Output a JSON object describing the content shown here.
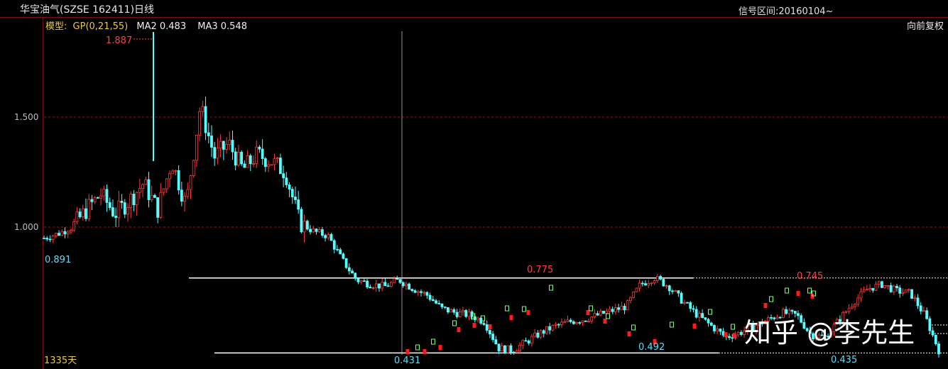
{
  "header": {
    "title": "华宝油气(SZSE 162411)日线",
    "signal_range": "信号区间:20160104~",
    "adjust": "向前复权",
    "period_days": "1335天"
  },
  "indicators": {
    "label": "模型:",
    "gp": "GP(0,21,55)",
    "ma2": "MA2 0.483",
    "ma3": "MA3 0.548"
  },
  "watermark": "知乎 @李先生",
  "colors": {
    "up": "#ff3c3c",
    "down": "#54ffff",
    "grid": "#8b1a1a",
    "buy": "#ff1a1a",
    "sell": "#7cff7c"
  },
  "chart_data": {
    "type": "candlestick",
    "ylim": [
      0.43,
      1.9
    ],
    "yticks": [
      {
        "value": 1.5,
        "label": "1.500"
      },
      {
        "value": 1.0,
        "label": "1.000"
      }
    ],
    "annotations": [
      {
        "label": "1.887",
        "value": 1.887,
        "kind": "high",
        "color": "#ff4040"
      },
      {
        "label": "0.891",
        "value": 0.891,
        "kind": "low",
        "color": "#54e0ff"
      },
      {
        "label": "0.775",
        "value": 0.775,
        "kind": "high",
        "color": "#ff4040"
      },
      {
        "label": "0.745",
        "value": 0.745,
        "kind": "high",
        "color": "#ff4040"
      },
      {
        "label": "0.492",
        "value": 0.492,
        "kind": "low",
        "color": "#54e0ff"
      },
      {
        "label": "0.431",
        "value": 0.431,
        "kind": "low",
        "color": "#54e0ff"
      },
      {
        "label": "0.435",
        "value": 0.435,
        "kind": "low",
        "color": "#54e0ff"
      }
    ],
    "resistance": 0.775,
    "support": 0.431,
    "price_path": [
      0.95,
      0.97,
      1.0,
      1.08,
      1.15,
      1.06,
      1.12,
      1.2,
      1.08,
      1.3,
      1.1,
      1.55,
      1.32,
      1.38,
      1.26,
      1.33,
      1.3,
      1.25,
      1.02,
      0.98,
      0.96,
      0.85,
      0.76,
      0.74,
      0.73,
      0.76,
      0.72,
      0.69,
      0.63,
      0.61,
      0.6,
      0.57,
      0.45,
      0.44,
      0.48,
      0.52,
      0.55,
      0.57,
      0.58,
      0.6,
      0.62,
      0.64,
      0.74,
      0.77,
      0.73,
      0.66,
      0.6,
      0.55,
      0.5,
      0.52,
      0.55,
      0.58,
      0.61,
      0.6,
      0.51,
      0.5,
      0.58,
      0.66,
      0.72,
      0.74,
      0.71,
      0.7,
      0.6,
      0.44
    ]
  }
}
